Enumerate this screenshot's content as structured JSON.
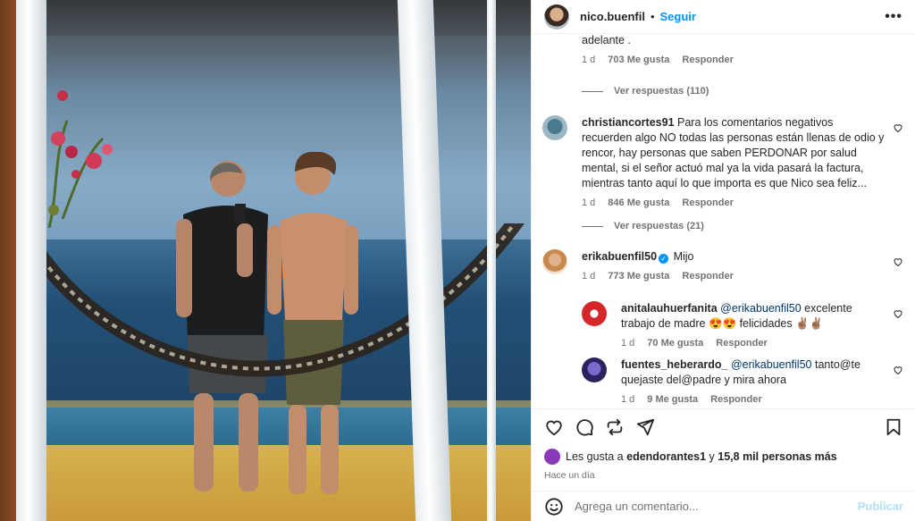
{
  "post": {
    "username": "nico.buenfil",
    "follow_label": "Seguir",
    "more_label": "•••"
  },
  "comments": [
    {
      "text_tail": "adelante .",
      "time": "1 d",
      "likes": "703 Me gusta",
      "reply_label": "Responder",
      "view_replies": "Ver respuestas (110)"
    },
    {
      "username": "christiancortes91",
      "text": "Para los comentarios negativos recuerden algo NO todas las personas están llenas de odio y rencor, hay personas que saben PERDONAR por salud mental, si el señor actuó mal ya la vida pasará la factura, mientras tanto aquí lo que importa es que Nico sea feliz...",
      "time": "1 d",
      "likes": "846 Me gusta",
      "reply_label": "Responder",
      "view_replies": "Ver respuestas (21)"
    },
    {
      "username": "erikabuenfil50",
      "text": "Mijo",
      "time": "1 d",
      "likes": "773 Me gusta",
      "reply_label": "Responder"
    }
  ],
  "replies": [
    {
      "username": "anitalauhuerfanita",
      "mention": "@erikabuenfil50",
      "text": "excelente trabajo de madre 😍😍 felicidades ✌🏽✌🏽",
      "time": "1 d",
      "likes": "70 Me gusta",
      "reply_label": "Responder"
    },
    {
      "username": "fuentes_heberardo_",
      "mention": "@erikabuenfil50",
      "text": "tanto@te quejaste del@padre y mira ahora",
      "time": "1 d",
      "likes": "9 Me gusta",
      "reply_label": "Responder"
    }
  ],
  "likes_summary": {
    "prefix": "Les gusta a",
    "user": "edendorantes1",
    "middle": "y",
    "others": "15,8 mil personas más"
  },
  "timestamp": "Hace un día",
  "comment_box": {
    "placeholder": "Agrega un comentario...",
    "publish_label": "Publicar"
  },
  "colors": {
    "accent": "#0095f6",
    "publish_disabled": "#b2dffc",
    "secondary_text": "#737373"
  }
}
